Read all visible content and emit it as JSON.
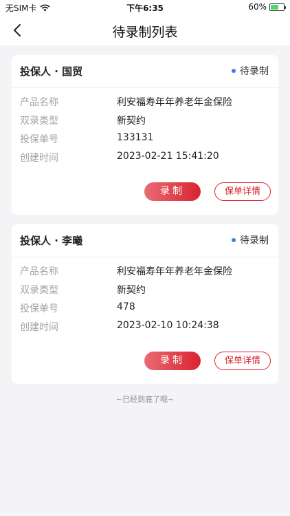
{
  "status_bar": {
    "carrier": "无SIM卡",
    "time": "下午6:35",
    "battery": "60%",
    "battery_level": 0.6
  },
  "nav": {
    "title": "待录制列表",
    "back_icon": "chevron-left-icon"
  },
  "cards": [
    {
      "holder": "投保人 · 国贸",
      "status": "待录制",
      "fields": [
        {
          "label": "产品名称",
          "value": "利安福寿年年养老年金保险"
        },
        {
          "label": "双录类型",
          "value": "新契约"
        },
        {
          "label": "投保单号",
          "value": "133131"
        },
        {
          "label": "创建时间",
          "value": "2023-02-21 15:41:20"
        }
      ],
      "record_label": "录制",
      "detail_label": "保单详情"
    },
    {
      "holder": "投保人 · 李曦",
      "status": "待录制",
      "fields": [
        {
          "label": "产品名称",
          "value": "利安福寿年年养老年金保险"
        },
        {
          "label": "双录类型",
          "value": "新契约"
        },
        {
          "label": "投保单号",
          "value": "478"
        },
        {
          "label": "创建时间",
          "value": "2023-02-10 10:24:38"
        }
      ],
      "record_label": "录制",
      "detail_label": "保单详情"
    }
  ],
  "footer_note": "~已经到底了哦~",
  "colors": {
    "accent": "#d9232f",
    "status_dot": "#3b7de9",
    "background": "#f4f4f6"
  }
}
